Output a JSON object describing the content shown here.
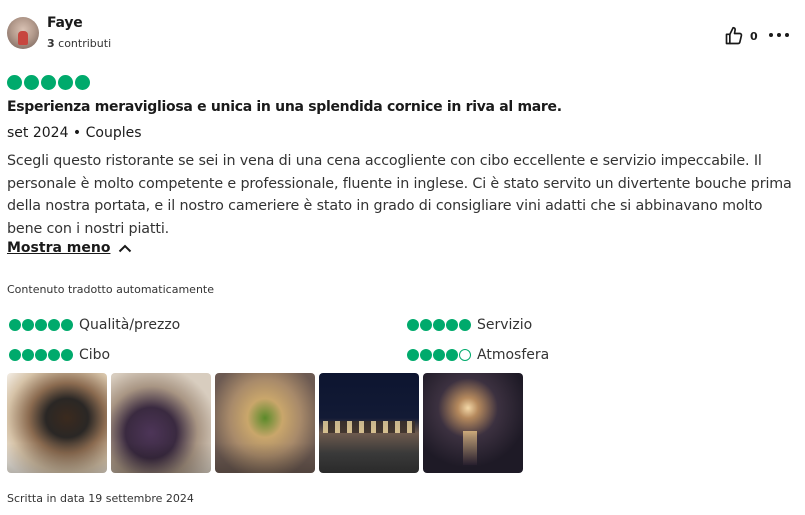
{
  "review": {
    "user": {
      "name": "Faye",
      "contrib_count": "3",
      "contrib_label": "contributi"
    },
    "helpful_count": "0",
    "rating": 5,
    "title": "Esperienza meravigliosa e unica in una splendida cornice in riva al mare.",
    "meta": "set 2024 • Couples",
    "body": "Scegli questo ristorante se sei in vena di una cena accogliente con cibo eccellente e servizio impeccabile. Il personale è molto competente e professionale, fluente in inglese. Ci è stato servito un divertente bouche prima della nostra portata, e il nostro cameriere è stato in grado di consigliare vini adatti che si abbinavano molto bene con i nostri piatti.",
    "toggle_label": "Mostra meno",
    "translated_note": "Contenuto tradotto automaticamente",
    "subratings": [
      {
        "label": "Qualità/prezzo",
        "value": 5
      },
      {
        "label": "Servizio",
        "value": 5
      },
      {
        "label": "Cibo",
        "value": 5
      },
      {
        "label": "Atmosfera",
        "value": 4
      }
    ],
    "photos": [
      {
        "icon": "seafood-dish-photo"
      },
      {
        "icon": "purple-crisps-photo"
      },
      {
        "icon": "fried-dish-photo"
      },
      {
        "icon": "terrace-night-photo"
      },
      {
        "icon": "moonlit-sea-photo"
      }
    ],
    "written_date": "Scritta in data 19 settembre 2024"
  },
  "colors": {
    "bubble": "#00aa6c",
    "text": "#1a1a1a"
  }
}
